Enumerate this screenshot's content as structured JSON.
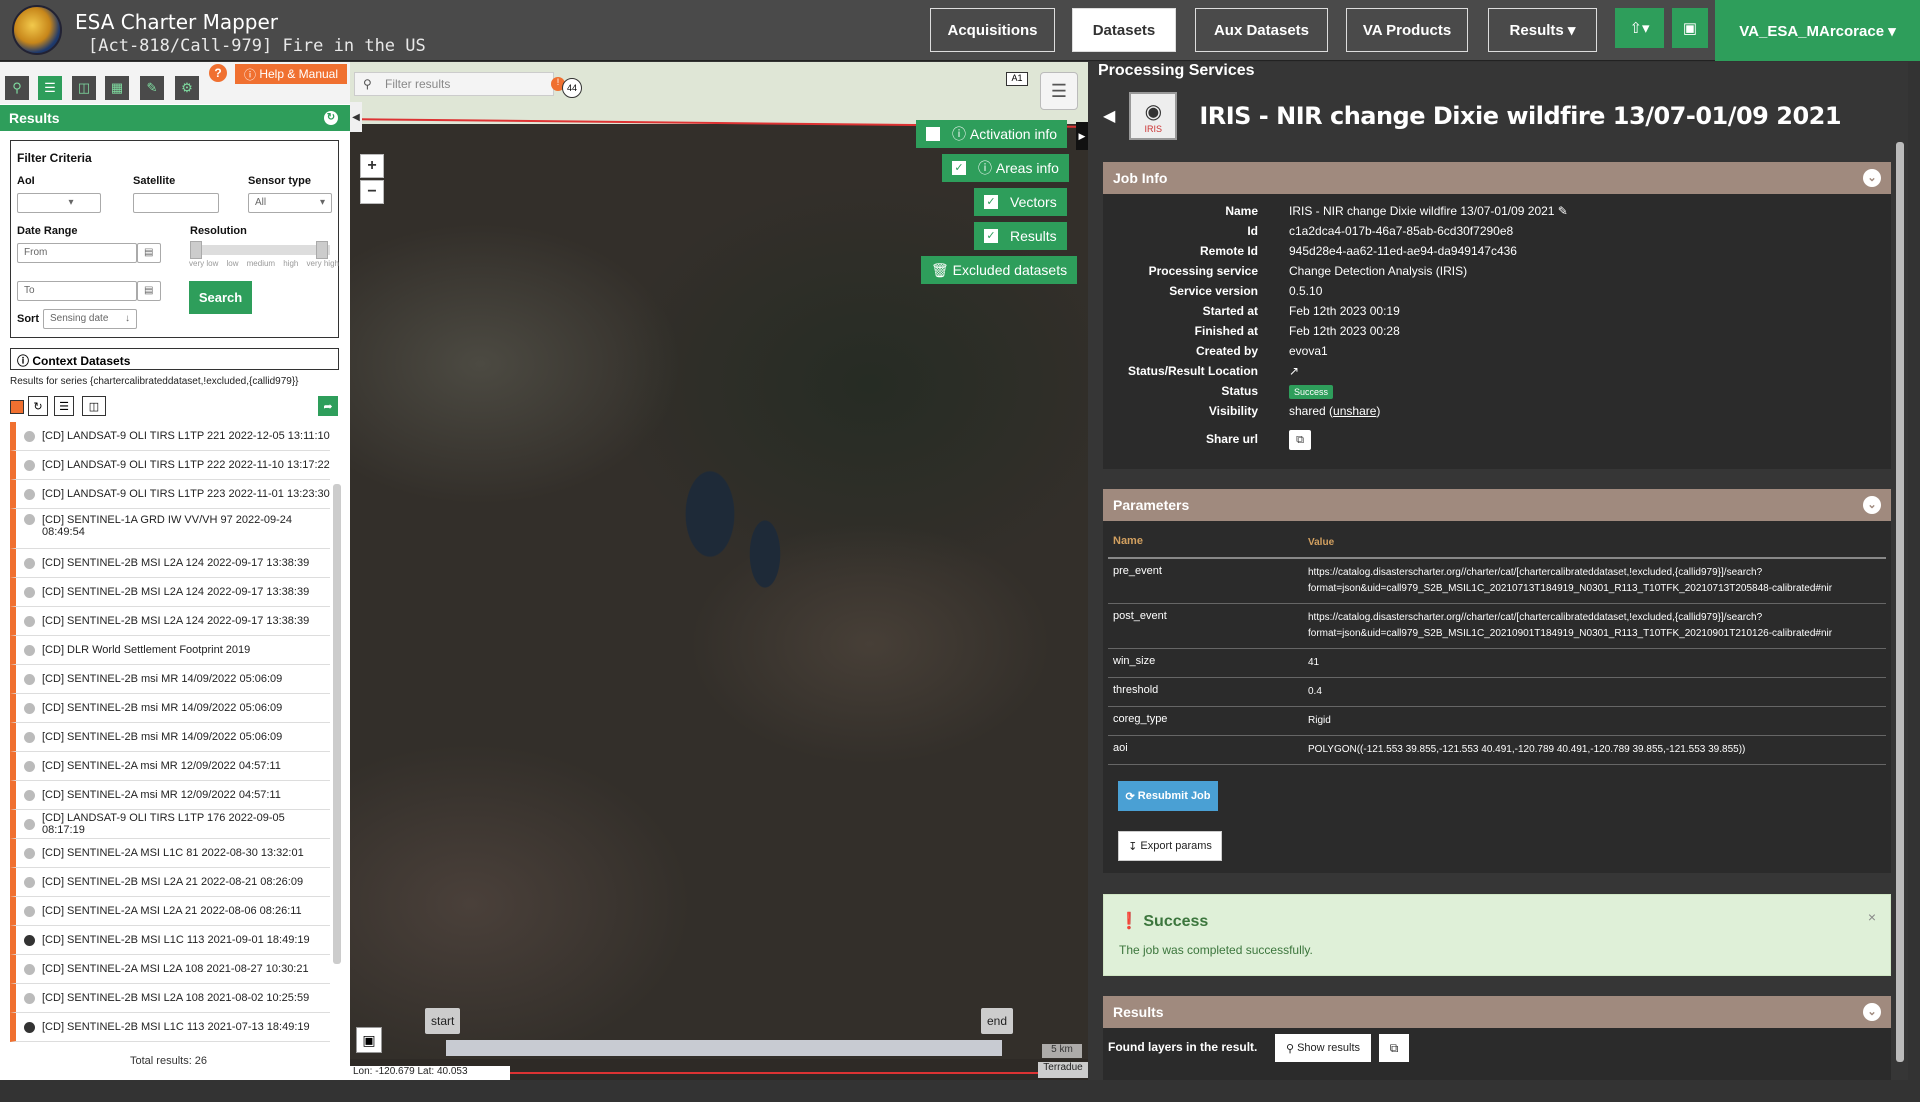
{
  "header": {
    "app_title": "ESA Charter Mapper",
    "activation": "[Act-818/Call-979] Fire in the US",
    "nav": [
      "Acquisitions",
      "Datasets",
      "Aux Datasets",
      "VA Products",
      "Results ▾"
    ],
    "active_nav": "Datasets",
    "user": "VA_ESA_MArcorace ▾"
  },
  "left": {
    "help_label": "Help & Manual",
    "results_title": "Results",
    "filter": {
      "title": "Filter Criteria",
      "aoi": "AoI",
      "satellite": "Satellite",
      "sensor_type": "Sensor type",
      "sensor_value": "All",
      "date_range": "Date Range",
      "from_placeholder": "From",
      "to_placeholder": "To",
      "resolution": "Resolution",
      "res_ticks": [
        "very low",
        "low",
        "medium",
        "high",
        "very high"
      ],
      "sort": "Sort",
      "sort_value": "Sensing date",
      "search": "Search"
    },
    "context_title": "Context Datasets",
    "series_text": "Results for series {chartercalibrateddataset,!excluded,{callid979}}",
    "items": [
      "[CD] LANDSAT-9 OLI TIRS L1TP 221 2022-12-05 13:11:10",
      "[CD] LANDSAT-9 OLI TIRS L1TP 222 2022-11-10 13:17:22",
      "[CD] LANDSAT-9 OLI TIRS L1TP 223 2022-11-01 13:23:30",
      "[CD] SENTINEL-1A GRD IW VV/VH 97 2022-09-24 08:49:54",
      "[CD] SENTINEL-2B MSI L2A 124 2022-09-17 13:38:39",
      "[CD] SENTINEL-2B MSI L2A 124 2022-09-17 13:38:39",
      "[CD] SENTINEL-2B MSI L2A 124 2022-09-17 13:38:39",
      "[CD] DLR World Settlement Footprint 2019",
      "[CD] SENTINEL-2B msi MR 14/09/2022 05:06:09",
      "[CD] SENTINEL-2B msi MR 14/09/2022 05:06:09",
      "[CD] SENTINEL-2B msi MR 14/09/2022 05:06:09",
      "[CD] SENTINEL-2A msi MR 12/09/2022 04:57:11",
      "[CD] SENTINEL-2A msi MR 12/09/2022 04:57:11",
      "[CD] LANDSAT-9 OLI TIRS L1TP 176 2022-09-05 08:17:19",
      "[CD] SENTINEL-2A MSI L1C 81 2022-08-30 13:32:01",
      "[CD] SENTINEL-2B MSI L2A 21 2022-08-21 08:26:09",
      "[CD] SENTINEL-2A MSI L2A 21 2022-08-06 08:26:11",
      "[CD] SENTINEL-2B MSI L1C 113 2021-09-01 18:49:19",
      "[CD] SENTINEL-2A MSI L2A 108 2021-08-27 10:30:21",
      "[CD] SENTINEL-2B MSI L2A 108 2021-08-02 10:25:59",
      "[CD] SENTINEL-2B MSI L1C 113 2021-07-13 18:49:19"
    ],
    "total": "Total results: 26"
  },
  "map": {
    "filter_placeholder": "Filter results",
    "activation_info": "Activation info",
    "areas_info": "Areas info",
    "vectors": "Vectors",
    "results": "Results",
    "excluded": "Excluded datasets",
    "start": "start",
    "end": "end",
    "scale": "5 km",
    "terradue": "Terradue",
    "coords": "Lon: -120.679 Lat: 40.053",
    "road_44": "44",
    "road_a1": "A1"
  },
  "right": {
    "section_title": "Processing Services",
    "job_title": "IRIS - NIR change Dixie wildfire 13/07-01/09 2021",
    "icon_label": "IRIS",
    "job_info": {
      "title": "Job Info",
      "rows": [
        {
          "k": "Name",
          "v": "IRIS - NIR change Dixie wildfire 13/07-01/09 2021 ✎"
        },
        {
          "k": "Id",
          "v": "c1a2dca4-017b-46a7-85ab-6cd30f7290e8"
        },
        {
          "k": "Remote Id",
          "v": "945d28e4-aa62-11ed-ae94-da949147c436"
        },
        {
          "k": "Processing service",
          "v": "Change Detection Analysis (IRIS)"
        },
        {
          "k": "Service version",
          "v": "0.5.10"
        },
        {
          "k": "Started at",
          "v": "Feb 12th 2023 00:19"
        },
        {
          "k": "Finished at",
          "v": "Feb 12th 2023 00:28"
        },
        {
          "k": "Created by",
          "v": "evova1"
        },
        {
          "k": "Status/Result Location",
          "v": "↗"
        }
      ],
      "status_label": "Status",
      "status_value": "Success",
      "visibility_label": "Visibility",
      "visibility_value": "shared",
      "unshare": "unshare",
      "share_label": "Share url"
    },
    "parameters": {
      "title": "Parameters",
      "col_name": "Name",
      "col_value": "Value",
      "rows": [
        {
          "k": "pre_event",
          "v": "https://catalog.disasterscharter.org//charter/cat/[chartercalibrateddataset,!excluded,{callid979}]/search?format=json&uid=call979_S2B_MSIL1C_20210713T184919_N0301_R113_T10TFK_20210713T205848-calibrated#nir"
        },
        {
          "k": "post_event",
          "v": "https://catalog.disasterscharter.org//charter/cat/[chartercalibrateddataset,!excluded,{callid979}]/search?format=json&uid=call979_S2B_MSIL1C_20210901T184919_N0301_R113_T10TFK_20210901T210126-calibrated#nir"
        },
        {
          "k": "win_size",
          "v": "41"
        },
        {
          "k": "threshold",
          "v": "0.4"
        },
        {
          "k": "coreg_type",
          "v": "Rigid"
        },
        {
          "k": "aoi",
          "v": "POLYGON((-121.553 39.855,-121.553 40.491,-120.789 40.491,-120.789 39.855,-121.553 39.855))"
        }
      ],
      "resubmit": "Resubmit Job",
      "export": "Export params"
    },
    "success": {
      "title": "Success",
      "message": "The job was completed successfully."
    },
    "results": {
      "title": "Results",
      "found": "Found layers in the result.",
      "show": "Show results"
    }
  }
}
